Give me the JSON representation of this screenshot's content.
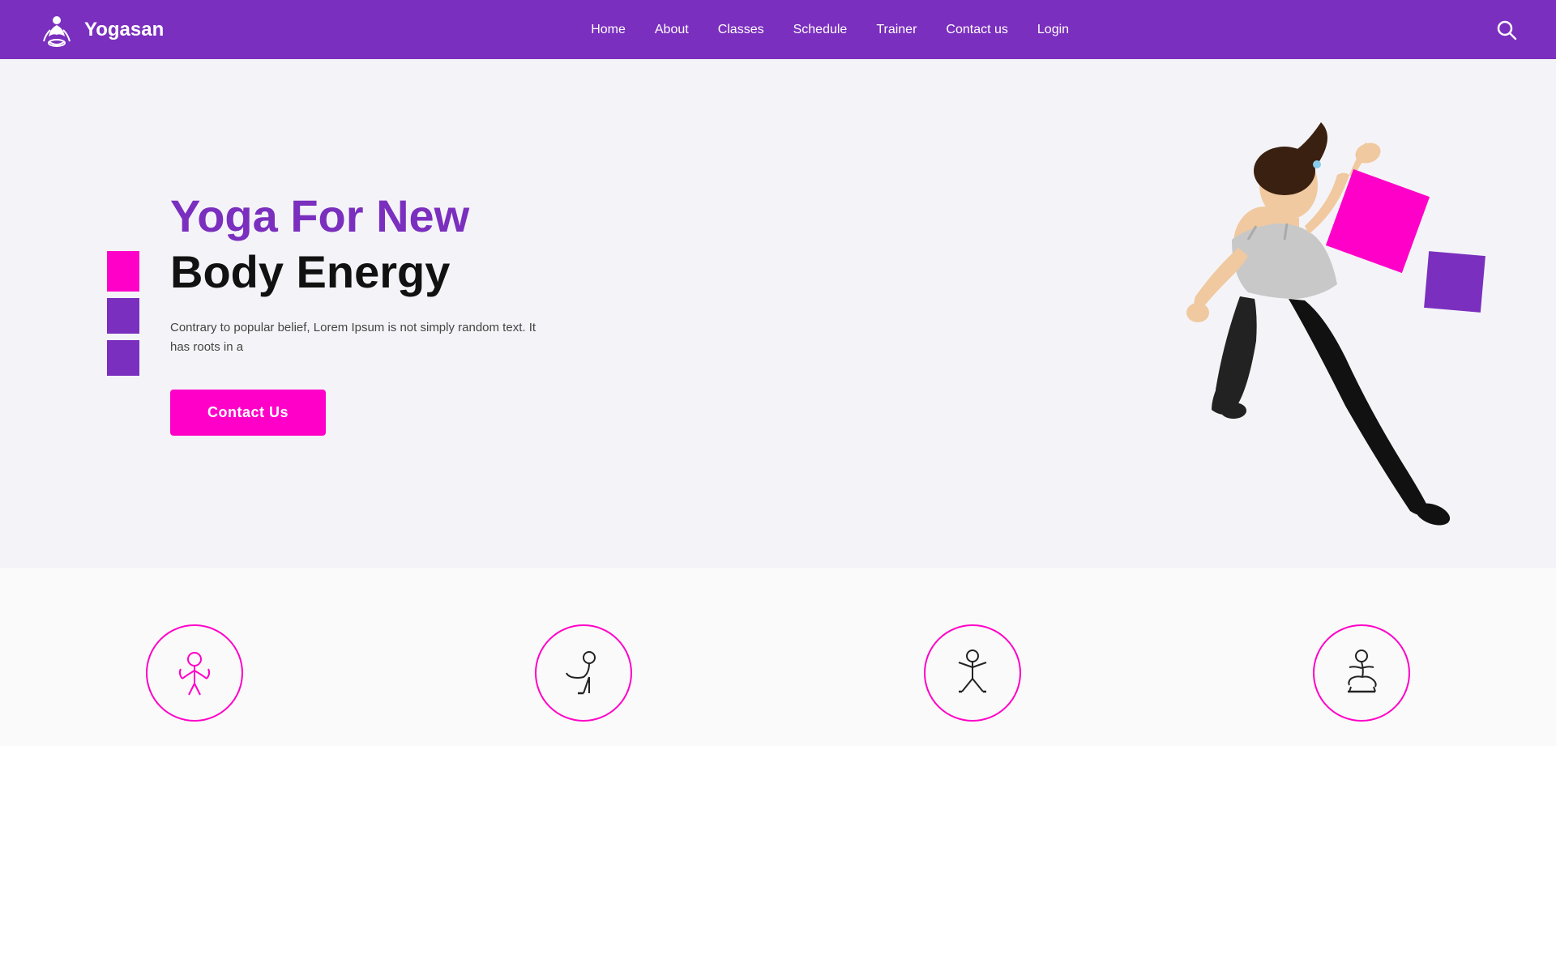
{
  "navbar": {
    "brand_name": "Yogasan",
    "links": [
      {
        "label": "Home",
        "id": "home"
      },
      {
        "label": "About",
        "id": "about"
      },
      {
        "label": "Classes",
        "id": "classes"
      },
      {
        "label": "Schedule",
        "id": "schedule"
      },
      {
        "label": "Trainer",
        "id": "trainer"
      },
      {
        "label": "Contact us",
        "id": "contact"
      },
      {
        "label": "Login",
        "id": "login"
      }
    ],
    "search_aria": "Search"
  },
  "hero": {
    "title_colored": "Yoga For New",
    "title_black": "Body Energy",
    "description": "Contrary to popular belief, Lorem Ipsum is not simply random text. It has roots in a",
    "cta_label": "Contact Us"
  },
  "bottom_icons": [
    {
      "id": "icon1"
    },
    {
      "id": "icon2"
    },
    {
      "id": "icon3"
    },
    {
      "id": "icon4"
    }
  ]
}
